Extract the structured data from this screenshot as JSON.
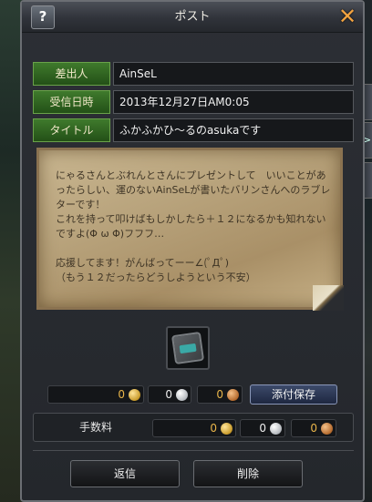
{
  "window": {
    "title": "ポスト",
    "help_label": "?"
  },
  "fields": [
    {
      "label": "差出人",
      "value": "AinSeL"
    },
    {
      "label": "受信日時",
      "value": "2013年12月27日AM0:05"
    },
    {
      "label": "タイトル",
      "value": "ふかふかひ～るのasukaです"
    }
  ],
  "letter": {
    "body": "にゃるさんとぶれんとさんにプレゼントして　いいことがあったらしい、運のないAinSeLが書いたバリンさんへのラブレターです！\nこれを持って叩けばもしかしたら＋１２になるかも知れないですよ(Φ ω Φ)フフフ…\n\n応援してます！がんばってーー∠(ﾟДﾟ)\n（もう１２だったらどうしようという不安）"
  },
  "attachment": {
    "icon": "scroll-item-icon"
  },
  "attach_money": {
    "gold": "0",
    "silver": "0",
    "bronze": "0"
  },
  "save_button": "添付保存",
  "fee": {
    "label": "手数料",
    "gold": "0",
    "silver": "0",
    "bronze": "0"
  },
  "buttons": {
    "reply": "返信",
    "delete": "削除"
  },
  "colors": {
    "label_green": "#2f6a22",
    "gold_text": "#e9b54a",
    "accent_close": "#f2a340"
  }
}
